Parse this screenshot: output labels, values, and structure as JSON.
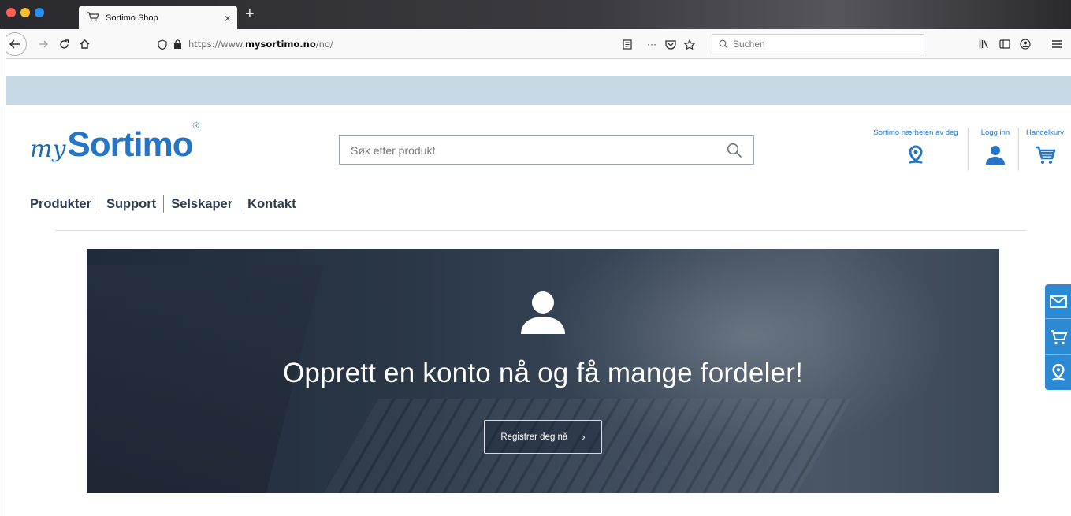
{
  "browser": {
    "tab_title": "Sortimo Shop",
    "new_tab_symbol": "+",
    "close_symbol": "×",
    "url_prefix": "https://www.",
    "url_domain": "mysortimo.no",
    "url_path": "/no/",
    "search_placeholder": "Suchen",
    "overflow_menu": "···"
  },
  "site": {
    "logo_my": "my",
    "logo_brand": "Sortimo",
    "logo_reg": "®",
    "search_placeholder": "Søk etter produkt",
    "utility": {
      "locator_label": "Sortimo nærheten av deg",
      "login_label": "Logg inn",
      "cart_label": "Handelkurv"
    },
    "nav": [
      "Produkter",
      "Support",
      "Selskaper",
      "Kontakt"
    ]
  },
  "hero": {
    "title": "Opprett en konto nå og få mange fordeler!",
    "button_label": "Registrer deg nå",
    "button_chevron": "›"
  },
  "colors": {
    "brand_blue": "#2475c6",
    "strip": "#c7d9e5",
    "float_bar": "#2b8ad2"
  },
  "icons": {
    "window_controls": [
      "close-dot",
      "minimize-dot",
      "zoom-dot"
    ],
    "toolbar": [
      "back-icon",
      "forward-icon",
      "reload-icon",
      "home-icon",
      "shield-icon",
      "lock-icon",
      "reader-icon",
      "pocket-icon",
      "star-icon",
      "library-icon",
      "sidebar-icon",
      "account-icon",
      "menu-icon"
    ],
    "floating": [
      "mail-icon",
      "cart-icon",
      "location-icon"
    ]
  }
}
